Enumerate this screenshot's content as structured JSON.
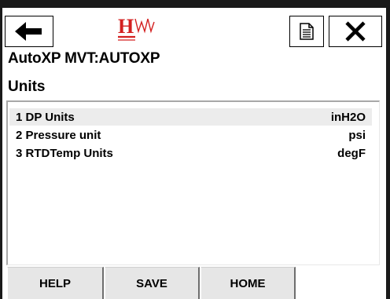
{
  "toolbar": {
    "back_icon": "arrow-left-icon",
    "logo_icon": "hw-logo",
    "document_icon": "document-icon",
    "close_icon": "close-x-icon"
  },
  "header": {
    "device_title": "AutoXP MVT:AUTOXP",
    "menu_title": "Units"
  },
  "menu": {
    "items": [
      {
        "label": "1 DP Units",
        "value": "inH2O",
        "selected": true
      },
      {
        "label": "2 Pressure unit",
        "value": "psi",
        "selected": false
      },
      {
        "label": "3 RTDTemp Units",
        "value": "degF",
        "selected": false
      }
    ]
  },
  "footer": {
    "help_label": "HELP",
    "save_label": "SAVE",
    "home_label": "HOME"
  },
  "colors": {
    "logo_red": "#d32020",
    "selection_bg": "#ececec",
    "button_bg": "#e6e6e6"
  }
}
